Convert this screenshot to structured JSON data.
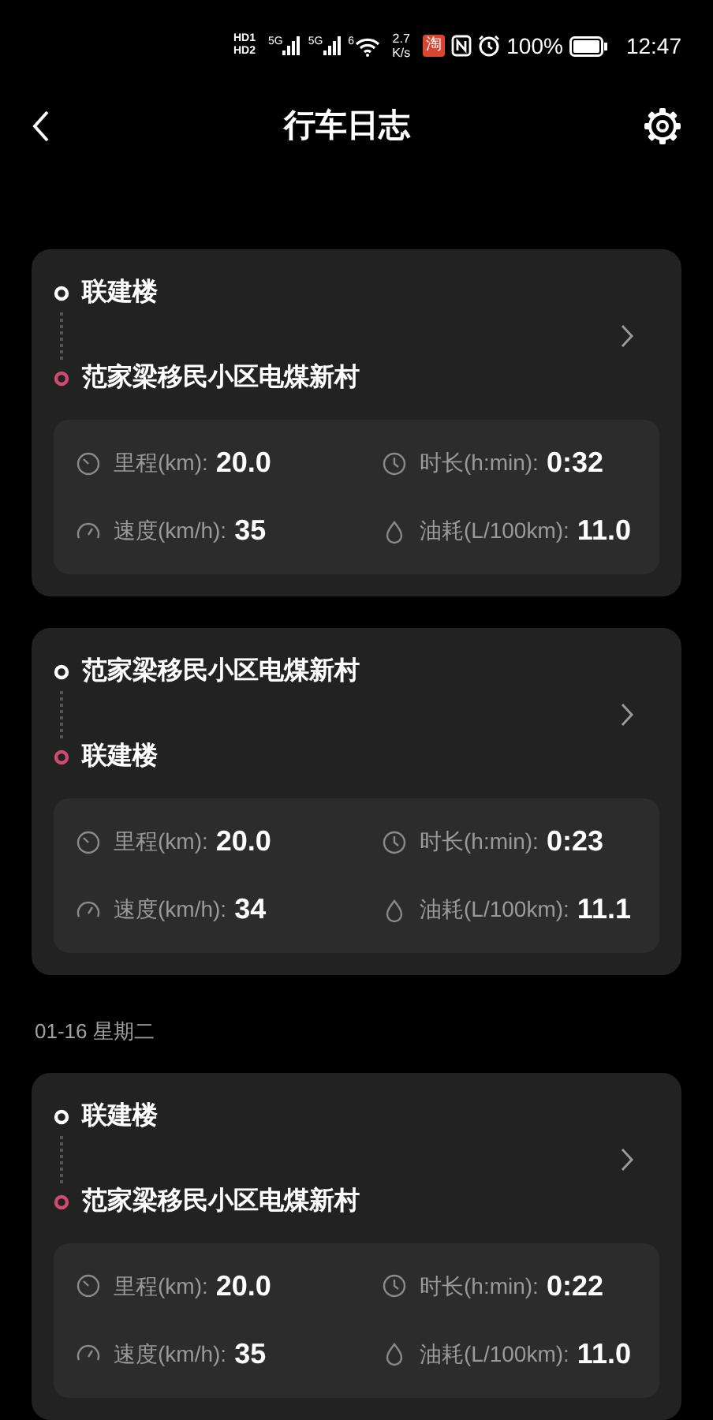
{
  "status_bar": {
    "sim_labels": [
      "HD1",
      "HD2"
    ],
    "signal_labels": [
      "5G",
      "5G"
    ],
    "wifi_label": "6",
    "net_speed": [
      "2.7",
      "K/s"
    ],
    "app_badge": "淘",
    "battery": "100%",
    "time": "12:47"
  },
  "header": {
    "title": "行车日志"
  },
  "items": [
    {
      "kind": "trip",
      "start": "联建楼",
      "end": "范家梁移民小区电煤新村",
      "stats": [
        {
          "kind": "distance",
          "label": "里程(km):",
          "value": "20.0"
        },
        {
          "kind": "duration",
          "label": "时长(h:min):",
          "value": "0:32"
        },
        {
          "kind": "speed",
          "label": "速度(km/h):",
          "value": "35"
        },
        {
          "kind": "fuel",
          "label": "油耗(L/100km):",
          "value": "11.0"
        }
      ]
    },
    {
      "kind": "trip",
      "start": "范家梁移民小区电煤新村",
      "end": "联建楼",
      "stats": [
        {
          "kind": "distance",
          "label": "里程(km):",
          "value": "20.0"
        },
        {
          "kind": "duration",
          "label": "时长(h:min):",
          "value": "0:23"
        },
        {
          "kind": "speed",
          "label": "速度(km/h):",
          "value": "34"
        },
        {
          "kind": "fuel",
          "label": "油耗(L/100km):",
          "value": "11.1"
        }
      ]
    },
    {
      "kind": "date",
      "text": "01-16 星期二"
    },
    {
      "kind": "trip",
      "start": "联建楼",
      "end": "范家梁移民小区电煤新村",
      "stats": [
        {
          "kind": "distance",
          "label": "里程(km):",
          "value": "20.0"
        },
        {
          "kind": "duration",
          "label": "时长(h:min):",
          "value": "0:22"
        },
        {
          "kind": "speed",
          "label": "速度(km/h):",
          "value": "35"
        },
        {
          "kind": "fuel",
          "label": "油耗(L/100km):",
          "value": "11.0"
        }
      ]
    }
  ]
}
